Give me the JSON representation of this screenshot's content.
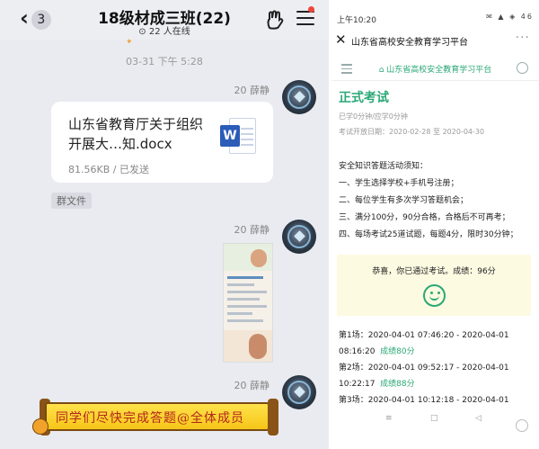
{
  "chat": {
    "back_count": "3",
    "title": "18级材成三班(22)",
    "online": "22 人在线",
    "timestamp": "03-31 下午 5:28",
    "sender": "20 薛静",
    "file": {
      "name": "山东省教育厅关于组织开展大…知.docx",
      "size": "81.56KB",
      "status": "已发送",
      "meta_sep": " / ",
      "icon_letter": "W"
    },
    "group_file_tag": "群文件",
    "banner_text": "同学们尽快完成答题@全体成员"
  },
  "phone": {
    "status_time": "上午10:20",
    "status_icons": "✉ ▲ ◈ 46",
    "app_title": "山东省高校安全教育学习平台",
    "site_name": "山东省高校安全教育学习平台",
    "exam_title": "正式考试",
    "duration": "已学0分钟/应学0分钟",
    "exam_dates": "考试开放日期：2020-02-28 至 2020-04-30",
    "notice": [
      "安全知识答题活动须知：",
      "一、学生选择学校+手机号注册；",
      "二、每位学生有多次学习答题机会；",
      "三、满分100分，90分合格，合格后不可再考；",
      "四、每场考试25道试题，每题4分，限时30分钟；"
    ],
    "result_text": "恭喜，你已通过考试。成绩：96分",
    "attempts": [
      {
        "line1": "第1场：2020-04-01 07:46:20 - 2020-04-01",
        "time": "08:16:20",
        "score": "成绩80分"
      },
      {
        "line1": "第2场：2020-04-01 09:52:17 - 2020-04-01",
        "time": "10:22:17",
        "score": "成绩88分"
      },
      {
        "line1": "第3场：2020-04-01 10:12:18 - 2020-04-01",
        "time": "",
        "score": ""
      }
    ],
    "nav_glyphs": [
      "≡",
      "□",
      "◁"
    ]
  },
  "colors": {
    "accent_green": "#2aa876",
    "chat_bg": "#e9ebf0",
    "word_blue": "#2b5cb8"
  }
}
